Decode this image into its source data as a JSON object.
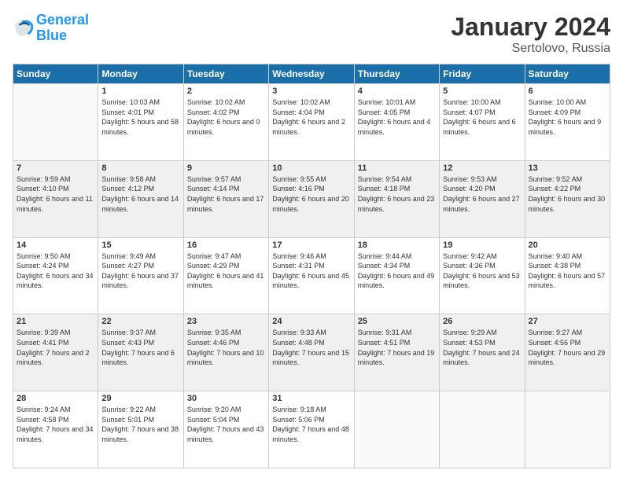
{
  "header": {
    "logo_line1": "General",
    "logo_line2": "Blue",
    "title": "January 2024",
    "subtitle": "Sertolovo, Russia"
  },
  "calendar": {
    "days_of_week": [
      "Sunday",
      "Monday",
      "Tuesday",
      "Wednesday",
      "Thursday",
      "Friday",
      "Saturday"
    ],
    "weeks": [
      [
        {
          "day": "",
          "sunrise": "",
          "sunset": "",
          "daylight": ""
        },
        {
          "day": "1",
          "sunrise": "Sunrise: 10:03 AM",
          "sunset": "Sunset: 4:01 PM",
          "daylight": "Daylight: 5 hours and 58 minutes."
        },
        {
          "day": "2",
          "sunrise": "Sunrise: 10:02 AM",
          "sunset": "Sunset: 4:02 PM",
          "daylight": "Daylight: 6 hours and 0 minutes."
        },
        {
          "day": "3",
          "sunrise": "Sunrise: 10:02 AM",
          "sunset": "Sunset: 4:04 PM",
          "daylight": "Daylight: 6 hours and 2 minutes."
        },
        {
          "day": "4",
          "sunrise": "Sunrise: 10:01 AM",
          "sunset": "Sunset: 4:05 PM",
          "daylight": "Daylight: 6 hours and 4 minutes."
        },
        {
          "day": "5",
          "sunrise": "Sunrise: 10:00 AM",
          "sunset": "Sunset: 4:07 PM",
          "daylight": "Daylight: 6 hours and 6 minutes."
        },
        {
          "day": "6",
          "sunrise": "Sunrise: 10:00 AM",
          "sunset": "Sunset: 4:09 PM",
          "daylight": "Daylight: 6 hours and 9 minutes."
        }
      ],
      [
        {
          "day": "7",
          "sunrise": "Sunrise: 9:59 AM",
          "sunset": "Sunset: 4:10 PM",
          "daylight": "Daylight: 6 hours and 11 minutes."
        },
        {
          "day": "8",
          "sunrise": "Sunrise: 9:58 AM",
          "sunset": "Sunset: 4:12 PM",
          "daylight": "Daylight: 6 hours and 14 minutes."
        },
        {
          "day": "9",
          "sunrise": "Sunrise: 9:57 AM",
          "sunset": "Sunset: 4:14 PM",
          "daylight": "Daylight: 6 hours and 17 minutes."
        },
        {
          "day": "10",
          "sunrise": "Sunrise: 9:55 AM",
          "sunset": "Sunset: 4:16 PM",
          "daylight": "Daylight: 6 hours and 20 minutes."
        },
        {
          "day": "11",
          "sunrise": "Sunrise: 9:54 AM",
          "sunset": "Sunset: 4:18 PM",
          "daylight": "Daylight: 6 hours and 23 minutes."
        },
        {
          "day": "12",
          "sunrise": "Sunrise: 9:53 AM",
          "sunset": "Sunset: 4:20 PM",
          "daylight": "Daylight: 6 hours and 27 minutes."
        },
        {
          "day": "13",
          "sunrise": "Sunrise: 9:52 AM",
          "sunset": "Sunset: 4:22 PM",
          "daylight": "Daylight: 6 hours and 30 minutes."
        }
      ],
      [
        {
          "day": "14",
          "sunrise": "Sunrise: 9:50 AM",
          "sunset": "Sunset: 4:24 PM",
          "daylight": "Daylight: 6 hours and 34 minutes."
        },
        {
          "day": "15",
          "sunrise": "Sunrise: 9:49 AM",
          "sunset": "Sunset: 4:27 PM",
          "daylight": "Daylight: 6 hours and 37 minutes."
        },
        {
          "day": "16",
          "sunrise": "Sunrise: 9:47 AM",
          "sunset": "Sunset: 4:29 PM",
          "daylight": "Daylight: 6 hours and 41 minutes."
        },
        {
          "day": "17",
          "sunrise": "Sunrise: 9:46 AM",
          "sunset": "Sunset: 4:31 PM",
          "daylight": "Daylight: 6 hours and 45 minutes."
        },
        {
          "day": "18",
          "sunrise": "Sunrise: 9:44 AM",
          "sunset": "Sunset: 4:34 PM",
          "daylight": "Daylight: 6 hours and 49 minutes."
        },
        {
          "day": "19",
          "sunrise": "Sunrise: 9:42 AM",
          "sunset": "Sunset: 4:36 PM",
          "daylight": "Daylight: 6 hours and 53 minutes."
        },
        {
          "day": "20",
          "sunrise": "Sunrise: 9:40 AM",
          "sunset": "Sunset: 4:38 PM",
          "daylight": "Daylight: 6 hours and 57 minutes."
        }
      ],
      [
        {
          "day": "21",
          "sunrise": "Sunrise: 9:39 AM",
          "sunset": "Sunset: 4:41 PM",
          "daylight": "Daylight: 7 hours and 2 minutes."
        },
        {
          "day": "22",
          "sunrise": "Sunrise: 9:37 AM",
          "sunset": "Sunset: 4:43 PM",
          "daylight": "Daylight: 7 hours and 6 minutes."
        },
        {
          "day": "23",
          "sunrise": "Sunrise: 9:35 AM",
          "sunset": "Sunset: 4:46 PM",
          "daylight": "Daylight: 7 hours and 10 minutes."
        },
        {
          "day": "24",
          "sunrise": "Sunrise: 9:33 AM",
          "sunset": "Sunset: 4:48 PM",
          "daylight": "Daylight: 7 hours and 15 minutes."
        },
        {
          "day": "25",
          "sunrise": "Sunrise: 9:31 AM",
          "sunset": "Sunset: 4:51 PM",
          "daylight": "Daylight: 7 hours and 19 minutes."
        },
        {
          "day": "26",
          "sunrise": "Sunrise: 9:29 AM",
          "sunset": "Sunset: 4:53 PM",
          "daylight": "Daylight: 7 hours and 24 minutes."
        },
        {
          "day": "27",
          "sunrise": "Sunrise: 9:27 AM",
          "sunset": "Sunset: 4:56 PM",
          "daylight": "Daylight: 7 hours and 29 minutes."
        }
      ],
      [
        {
          "day": "28",
          "sunrise": "Sunrise: 9:24 AM",
          "sunset": "Sunset: 4:58 PM",
          "daylight": "Daylight: 7 hours and 34 minutes."
        },
        {
          "day": "29",
          "sunrise": "Sunrise: 9:22 AM",
          "sunset": "Sunset: 5:01 PM",
          "daylight": "Daylight: 7 hours and 38 minutes."
        },
        {
          "day": "30",
          "sunrise": "Sunrise: 9:20 AM",
          "sunset": "Sunset: 5:04 PM",
          "daylight": "Daylight: 7 hours and 43 minutes."
        },
        {
          "day": "31",
          "sunrise": "Sunrise: 9:18 AM",
          "sunset": "Sunset: 5:06 PM",
          "daylight": "Daylight: 7 hours and 48 minutes."
        },
        {
          "day": "",
          "sunrise": "",
          "sunset": "",
          "daylight": ""
        },
        {
          "day": "",
          "sunrise": "",
          "sunset": "",
          "daylight": ""
        },
        {
          "day": "",
          "sunrise": "",
          "sunset": "",
          "daylight": ""
        }
      ]
    ]
  }
}
